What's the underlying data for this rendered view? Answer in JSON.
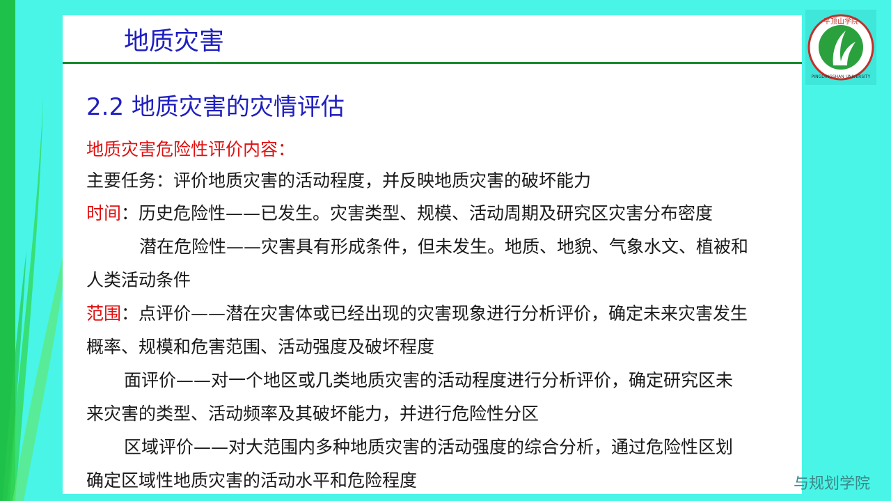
{
  "header": {
    "title": "地质灾害"
  },
  "section": {
    "heading": "2.2 地质灾害的灾情评估"
  },
  "content": {
    "line1": "地质灾害危险性评价内容：",
    "line2": "主要任务：评价地质灾害的活动程度，并反映地质灾害的破坏能力",
    "line3_label": "时间",
    "line3_text": "：历史危险性——已发生。灾害类型、规模、活动周期及研究区灾害分布密度",
    "line4": "潜在危险性——灾害具有形成条件，但未发生。地质、地貌、气象水文、植被和",
    "line5": "人类活动条件",
    "line6_label": "范围",
    "line6_text": "：点评价——潜在灾害体或已经出现的灾害现象进行分析评价，确定未来灾害发生",
    "line7": "概率、规模和危害范围、活动强度及破坏程度",
    "line8": "面评价——对一个地区或几类地质灾害的活动程度进行分析评价，确定研究区未",
    "line9": "来灾害的类型、活动频率及其破坏能力，并进行危险性分区",
    "line10": "区域评价——对大范围内多种地质灾害的活动强度的综合分析，通过危险性区划",
    "line11": "确定区域性地质灾害的活动水平和危险程度"
  },
  "logo": {
    "text_top": "平顶山学院",
    "text_bottom": "PINGDINGSHAN UNIVERSITY"
  },
  "footer": {
    "text": "与规划学院"
  },
  "colors": {
    "background": "#48f5e7",
    "accent_green": "#1ec24a",
    "title_blue": "#1f1fbf",
    "highlight_red": "#e01010"
  }
}
